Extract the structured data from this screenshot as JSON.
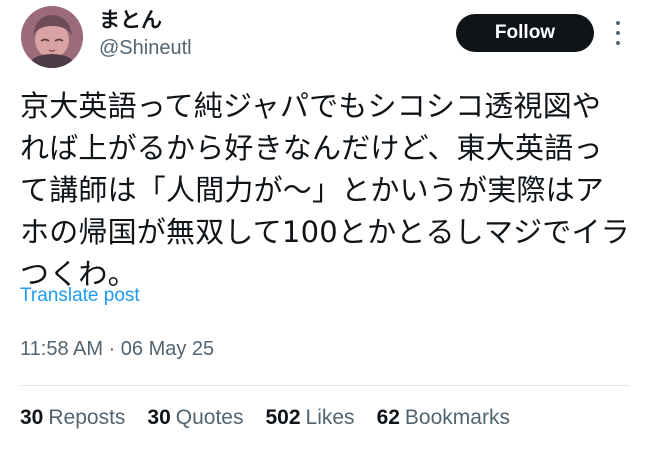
{
  "author": {
    "display_name": "まとん",
    "handle": "@Shineutl"
  },
  "follow_label": "Follow",
  "tweet": {
    "text": "京大英語って純ジャパでもシコシコ透視図やれば上がるから好きなんだけど、東大英語って講師は「人間力が〜」とかいうが実際はアホの帰国が無双して100とかとるしマジでイラつくわ。",
    "translate_label": "Translate post",
    "timestamp": "11:58 AM · 06 May 25"
  },
  "stats": {
    "reposts_count": "30",
    "reposts_label": "Reposts",
    "quotes_count": "30",
    "quotes_label": "Quotes",
    "likes_count": "502",
    "likes_label": "Likes",
    "bookmarks_count": "62",
    "bookmarks_label": "Bookmarks"
  },
  "colors": {
    "link": "#1d9bf0",
    "secondary_text": "#536471",
    "primary_text": "#0f1419",
    "follow_bg": "#0f1419"
  },
  "icons": {
    "more": "more-vertical-icon"
  }
}
